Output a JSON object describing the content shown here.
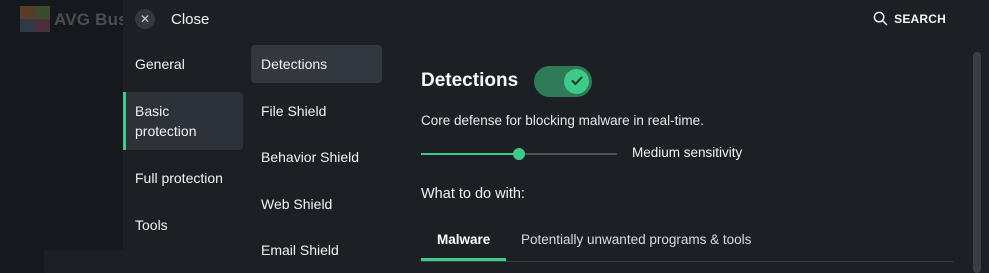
{
  "background_app": {
    "title": "AVG Bus"
  },
  "topbar": {
    "close_label": "Close",
    "search_label": "SEARCH"
  },
  "nav_primary": {
    "items": [
      {
        "label": "General",
        "active": false
      },
      {
        "label": "Basic protection",
        "active": true
      },
      {
        "label": "Full protection",
        "active": false
      },
      {
        "label": "Tools",
        "active": false
      }
    ]
  },
  "nav_secondary": {
    "items": [
      {
        "label": "Detections",
        "active": true
      },
      {
        "label": "File Shield",
        "active": false
      },
      {
        "label": "Behavior Shield",
        "active": false
      },
      {
        "label": "Web Shield",
        "active": false
      },
      {
        "label": "Email Shield",
        "active": false
      }
    ]
  },
  "content": {
    "heading": "Detections",
    "toggle_on": true,
    "description": "Core defense for blocking malware in real-time.",
    "sensitivity": {
      "label": "Medium sensitivity",
      "value": 0.5
    },
    "what_to_do_label": "What to do with:",
    "tabs": [
      {
        "label": "Malware",
        "active": true
      },
      {
        "label": "Potentially unwanted programs & tools",
        "active": false
      }
    ]
  },
  "colors": {
    "accent": "#3ecb8a",
    "panel_bg": "#1c2025",
    "toggle_bg": "#2f7a57"
  }
}
